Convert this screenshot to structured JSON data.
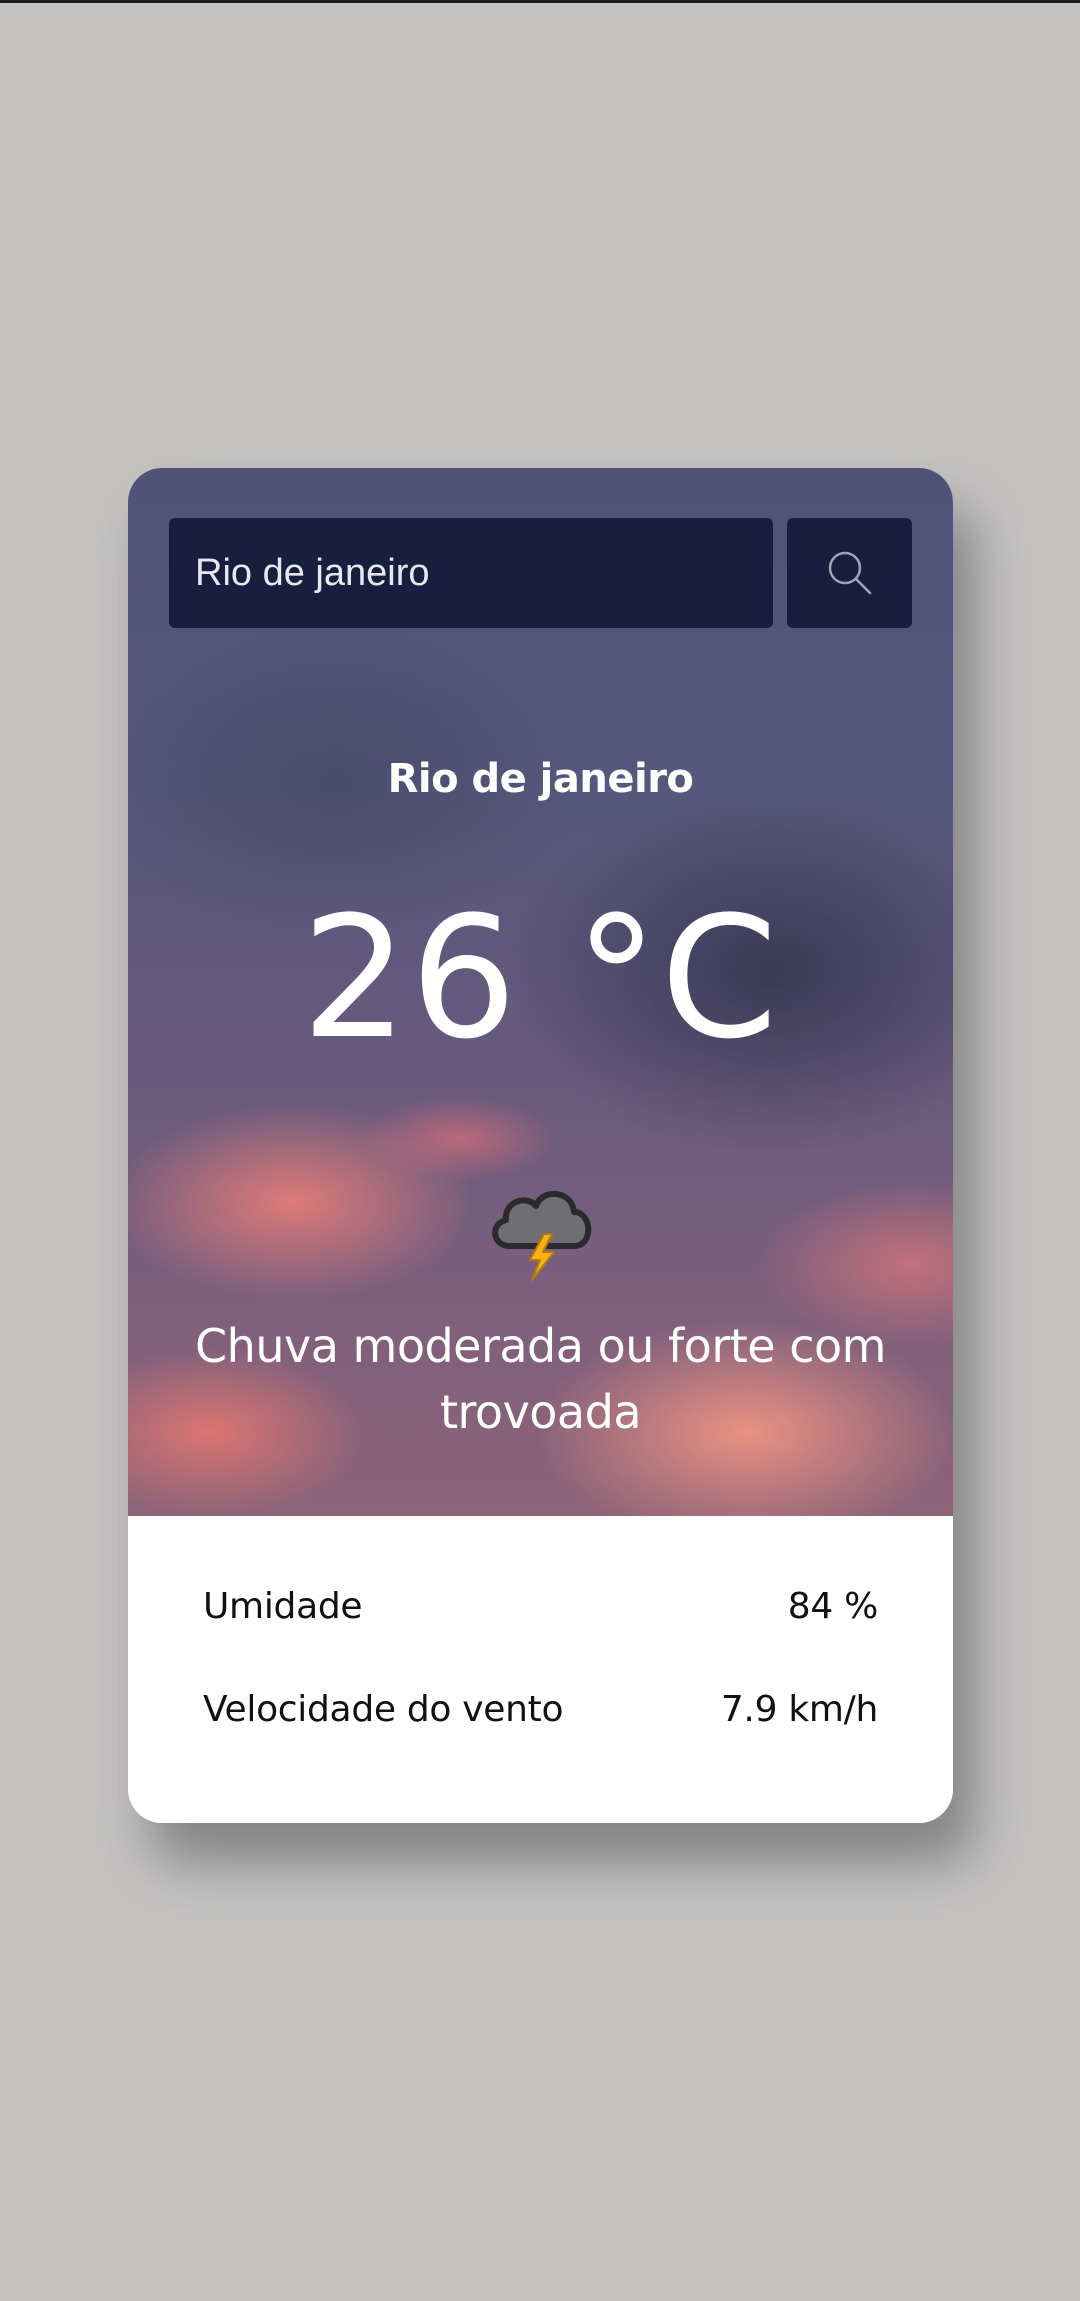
{
  "search": {
    "value": "Rio de janeiro",
    "button_icon": "search-icon"
  },
  "weather": {
    "city": "Rio de janeiro",
    "temperature": "26 °C",
    "icon": "thunderstorm-cloud-icon",
    "condition": "Chuva moderada ou forte com trovoada"
  },
  "details": {
    "humidity_label": "Umidade",
    "humidity_value": "84 %",
    "wind_label": "Velocidade do vento",
    "wind_value": "7.9 km/h"
  },
  "colors": {
    "page_background": "#c3c2c1",
    "search_background": "#181e3e",
    "details_background": "#ffffff"
  }
}
